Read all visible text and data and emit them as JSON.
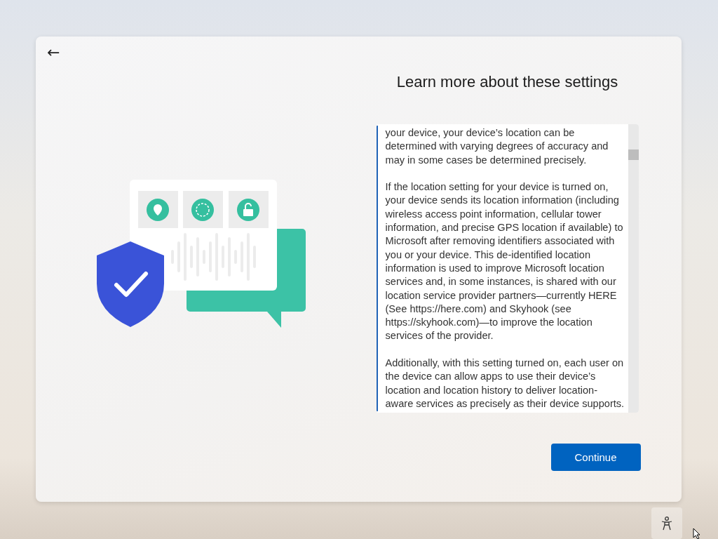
{
  "dialog": {
    "back_button": "←",
    "title": "Learn more about these settings",
    "paragraphs": [
      "your device, your device’s location can be determined with varying degrees of accuracy and may in some cases be determined precisely.",
      "If the location setting for your device is turned on, your device sends its location information (including wireless access point information, cellular tower information, and precise GPS location if available) to Microsoft after removing identifiers associated with you or your device. This de-identified location information is used to improve Microsoft location services and, in some instances, is shared with our location service provider partners—currently HERE (See https://here.com) and Skyhook (see https://skyhook.com)—to improve the location services of the provider.",
      "Additionally, with this setting turned on, each user on the device can allow apps to use their device’s location and location history to deliver location-aware services as precisely as their device supports."
    ],
    "continue_button": "Continue"
  }
}
